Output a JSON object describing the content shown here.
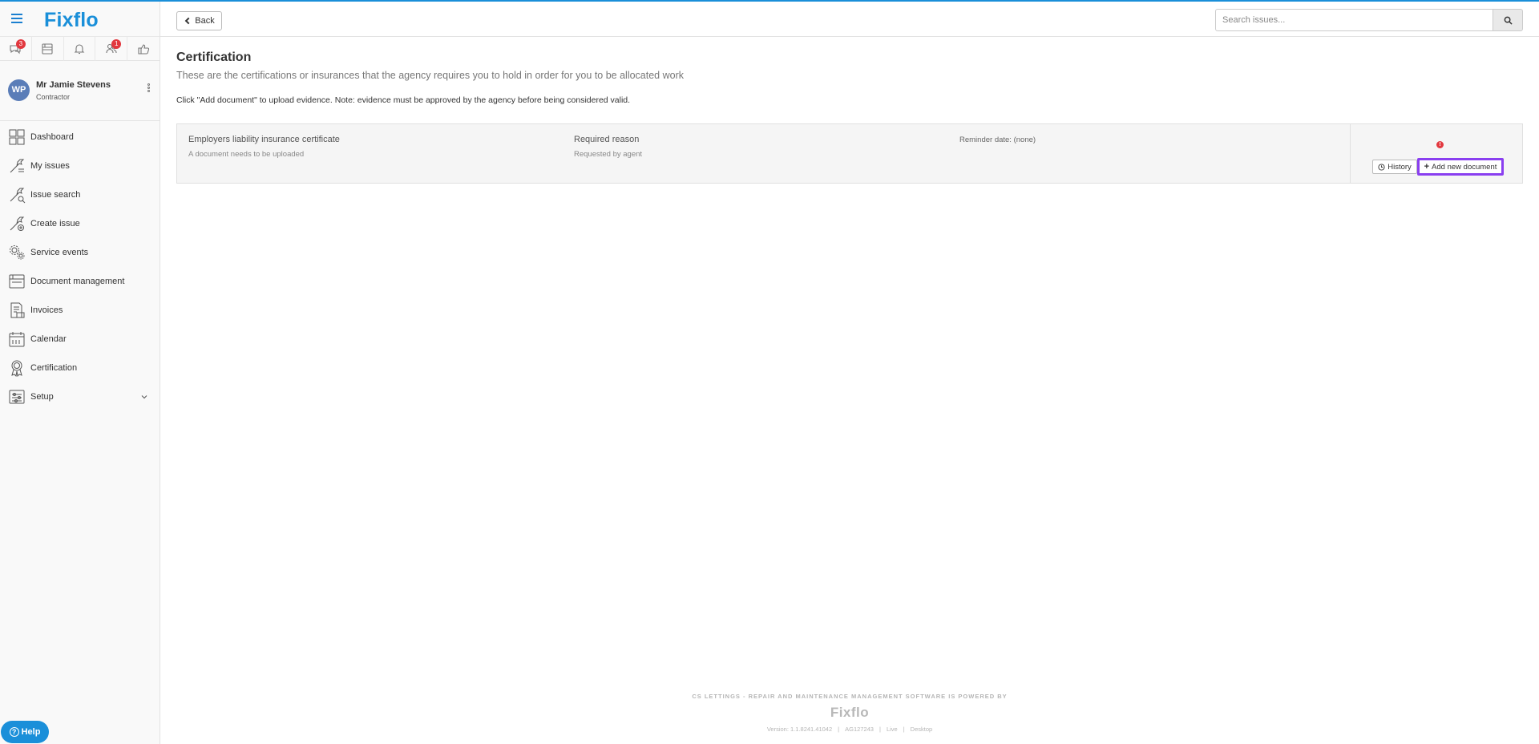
{
  "app": {
    "logo_text": "Fixflo",
    "accent_color": "#1a8fd9"
  },
  "iconbar": [
    {
      "icon": "chat-icon",
      "badge": "3"
    },
    {
      "icon": "inbox-icon",
      "badge": ""
    },
    {
      "icon": "bell-icon",
      "badge": ""
    },
    {
      "icon": "people-icon",
      "badge": "1"
    },
    {
      "icon": "thumbs-up-icon",
      "badge": ""
    }
  ],
  "profile": {
    "initials": "WP",
    "name": "Mr Jamie Stevens",
    "role": "Contractor"
  },
  "nav": [
    {
      "label": "Dashboard",
      "icon": "dashboard-icon"
    },
    {
      "label": "My issues",
      "icon": "my-issues-icon"
    },
    {
      "label": "Issue search",
      "icon": "issue-search-icon"
    },
    {
      "label": "Create issue",
      "icon": "create-issue-icon"
    },
    {
      "label": "Service events",
      "icon": "service-events-icon"
    },
    {
      "label": "Document management",
      "icon": "document-icon"
    },
    {
      "label": "Invoices",
      "icon": "invoice-icon"
    },
    {
      "label": "Calendar",
      "icon": "calendar-icon"
    },
    {
      "label": "Certification",
      "icon": "certification-icon"
    },
    {
      "label": "Setup",
      "icon": "setup-icon"
    }
  ],
  "help_label": "Help",
  "header": {
    "back_label": "Back",
    "search_placeholder": "Search issues..."
  },
  "page": {
    "title": "Certification",
    "subtitle": "These are the certifications or insurances that the agency requires you to hold in order for you to be allocated work",
    "note": "Click \"Add document\" to upload evidence. Note: evidence must be approved by the agency before being considered valid."
  },
  "certification": {
    "name": "Employers liability insurance certificate",
    "status": "A document needs to be uploaded",
    "reason_title": "Required reason",
    "reason_value": "Requested by agent",
    "reminder": "Reminder date: (none)",
    "warning_glyph": "!",
    "history_label": "History",
    "add_label": "Add new document"
  },
  "footer": {
    "tagline": "CS LETTINGS - REPAIR AND MAINTENANCE MANAGEMENT SOFTWARE IS POWERED BY",
    "logo_text": "Fixflo",
    "version": "Version: 1.1.8241.41042",
    "account": "AG127243",
    "env": "Live",
    "mode": "Desktop"
  }
}
